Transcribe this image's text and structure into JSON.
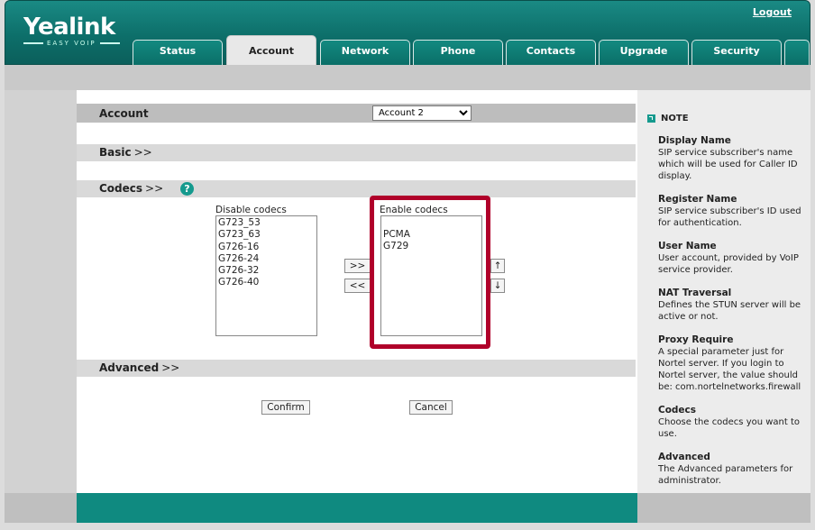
{
  "header": {
    "logo_text": "Yealink",
    "logo_sub": "EASY VOIP",
    "logout_label": "Logout",
    "tabs": [
      {
        "label": "Status",
        "active": false
      },
      {
        "label": "Account",
        "active": true
      },
      {
        "label": "Network",
        "active": false
      },
      {
        "label": "Phone",
        "active": false
      },
      {
        "label": "Contacts",
        "active": false
      },
      {
        "label": "Upgrade",
        "active": false
      },
      {
        "label": "Security",
        "active": false
      }
    ]
  },
  "account": {
    "label": "Account",
    "selected": "Account 2",
    "options": [
      "Account 2"
    ]
  },
  "sections": {
    "basic": "Basic",
    "codecs": "Codecs",
    "advanced": "Advanced",
    "arrow": ">>"
  },
  "help_icon": "?",
  "codecs": {
    "disable_label": "Disable codecs",
    "enable_label": "Enable codecs",
    "disabled": [
      "G723_53",
      "G723_63",
      "G726-16",
      "G726-24",
      "G726-32",
      "G726-40"
    ],
    "enabled": [
      "",
      "PCMA",
      "G729"
    ],
    "add_label": ">>",
    "remove_label": "<<",
    "up_label": "↑",
    "down_label": "↓"
  },
  "buttons": {
    "confirm": "Confirm",
    "cancel": "Cancel"
  },
  "highlight_color": "#b0002a",
  "note": {
    "heading": "NOTE",
    "items": [
      {
        "title": "Display Name",
        "text": "SIP service subscriber's name which will be used for Caller ID display."
      },
      {
        "title": "Register Name",
        "text": "SIP service subscriber's ID used for authentication."
      },
      {
        "title": "User Name",
        "text": "User account, provided by VoIP service provider."
      },
      {
        "title": "NAT Traversal",
        "text": "Defines the STUN server will be active or not."
      },
      {
        "title": "Proxy Require",
        "text": "A special parameter just for Nortel server. If you login to Nortel server, the value should be: com.nortelnetworks.firewall"
      },
      {
        "title": "Codecs",
        "text": "Choose the codecs you want to use."
      },
      {
        "title": "Advanced",
        "text": "The Advanced parameters for administrator."
      }
    ]
  }
}
